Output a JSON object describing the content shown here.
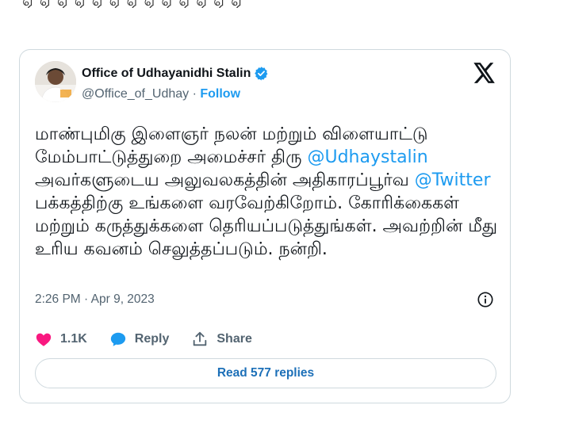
{
  "top_strip_text": "ஏ ஏ ஏ ஏ ஏ ஏ ஏ ஏ ஏ ஏ ஏ ஏ ஏ",
  "account": {
    "display_name": "Office of Udhayanidhi Stalin",
    "handle": "@Office_of_Udhay",
    "separator": " · ",
    "follow_label": "Follow"
  },
  "tweet": {
    "segments": [
      {
        "text": "மாண்புமிகு இளைஞர் நலன் மற்றும் விளையாட்டு மேம்பாட்டுத்துறை அமைச்சர் திரு "
      },
      {
        "text": "@Udhaystalin",
        "mention": true
      },
      {
        "text": " அவர்களுடைய அலுவலகத்தின் அதிகாரப்பூர்வ "
      },
      {
        "text": "@Twitter",
        "mention": true
      },
      {
        "text": " பக்கத்திற்கு உங்களை வரவேற்கிறோம். கோரிக்கைகள் மற்றும் கருத்துக்களை தெரியப்படுத்துங்கள். அவற்றின் மீது உரிய கவனம் செலுத்தப்படும். நன்றி."
      }
    ],
    "timestamp": "2:26 PM · Apr 9, 2023"
  },
  "actions": {
    "like_count": "1.1K",
    "reply_label": "Reply",
    "share_label": "Share"
  },
  "read_replies_label": "Read 577 replies",
  "colors": {
    "accent": "#1d9bf0",
    "like": "#f91880",
    "reply_icon": "#1d9bf0",
    "border": "#cfd9de",
    "muted": "#536471"
  },
  "icons": [
    "verified-badge-icon",
    "x-logo-icon",
    "info-icon",
    "heart-icon",
    "reply-bubble-icon",
    "share-icon"
  ]
}
